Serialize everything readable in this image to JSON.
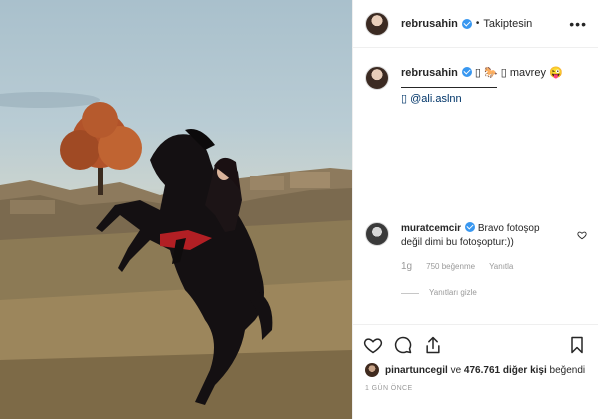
{
  "header": {
    "username": "rebrusahin",
    "separator": "•",
    "follow_state": "Takiptesin",
    "more_label": "•••"
  },
  "caption": {
    "username": "rebrusahin",
    "text": "▯ 🐎 ▯ mavrey 😜",
    "mention_line": "▯ @ali.aslnn"
  },
  "comment": {
    "username": "muratcemcir",
    "text": "Bravo fotoşop değil dimi bu fotoşoptur:))",
    "time": "1g",
    "likes": "750 beğenme",
    "reply": "Yanıtla",
    "hide_replies": "Yanıtları gizle"
  },
  "likes_line": {
    "username": "pinartuncegil",
    "middle": " ve ",
    "count": "476.761 diğer kişi",
    "suffix": " beğendi"
  },
  "timestamp": "1 GÜN ÖNCE",
  "colors": {
    "verified": "#3897f0",
    "muted_text": "#999999",
    "link": "#003569"
  },
  "icons": [
    "heart-icon",
    "comment-icon",
    "share-icon",
    "bookmark-icon",
    "verified-icon",
    "more-icon"
  ]
}
